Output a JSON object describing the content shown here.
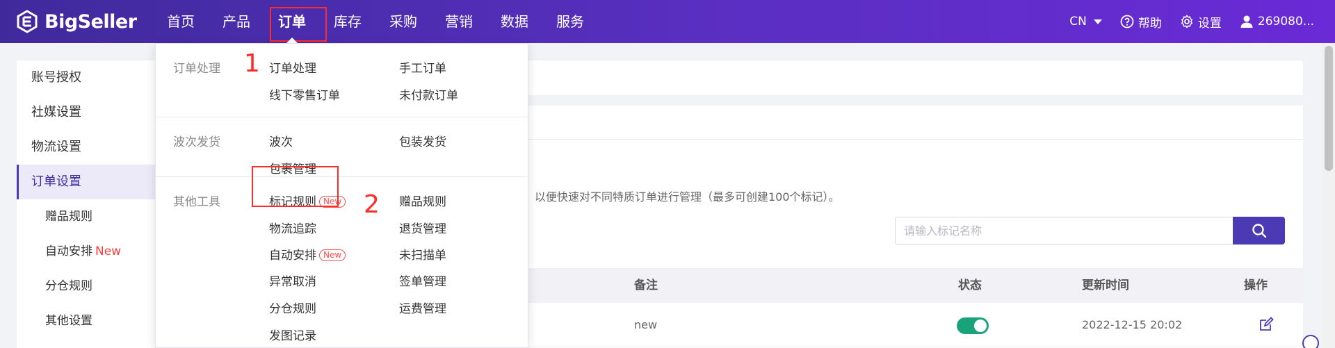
{
  "brand": {
    "name": "BigSeller"
  },
  "nav": [
    {
      "label": "首页"
    },
    {
      "label": "产品"
    },
    {
      "label": "订单"
    },
    {
      "label": "库存"
    },
    {
      "label": "采购"
    },
    {
      "label": "营销"
    },
    {
      "label": "数据"
    },
    {
      "label": "服务"
    }
  ],
  "topright": {
    "lang": "CN",
    "help": "帮助",
    "settings": "设置",
    "user": "269080..."
  },
  "sidebar": {
    "items": [
      {
        "label": "账号授权"
      },
      {
        "label": "社媒设置"
      },
      {
        "label": "物流设置"
      },
      {
        "label": "订单设置"
      },
      {
        "label": "赠品规则"
      },
      {
        "label": "自动安排",
        "badge": "New"
      },
      {
        "label": "分仓规则"
      },
      {
        "label": "其他设置"
      }
    ]
  },
  "dropdown": {
    "sections": [
      {
        "title": "订单处理",
        "links": [
          "订单处理",
          "手工订单",
          "线下零售订单",
          "未付款订单"
        ]
      },
      {
        "title": "波次发货",
        "links": [
          "波次",
          "包装发货",
          "包裹管理"
        ]
      },
      {
        "title": "其他工具",
        "links": [
          "标记规则",
          "赠品规则",
          "物流追踪",
          "退货管理",
          "自动安排",
          "未扫描单",
          "异常取消",
          "签单管理",
          "分仓规则",
          "运费管理",
          "发图记录"
        ]
      }
    ],
    "new_tag": "New"
  },
  "annotations": {
    "first": "1",
    "second": "2"
  },
  "main": {
    "description": "以便快速对不同特质订单进行管理（最多可创建100个标记）。",
    "search": {
      "placeholder": "请输入标记名称"
    },
    "table": {
      "columns": [
        "备注",
        "状态",
        "更新时间",
        "操作"
      ],
      "rows": [
        {
          "remark": "new",
          "status_on": true,
          "updated": "2022-12-15 20:02"
        }
      ]
    }
  },
  "colors": {
    "brand_start": "#3f2a9c",
    "brand_end": "#6a2ad6",
    "accent": "#4a3bb5",
    "highlight": "#ff2b2b",
    "toggle_on": "#1aa37a"
  }
}
